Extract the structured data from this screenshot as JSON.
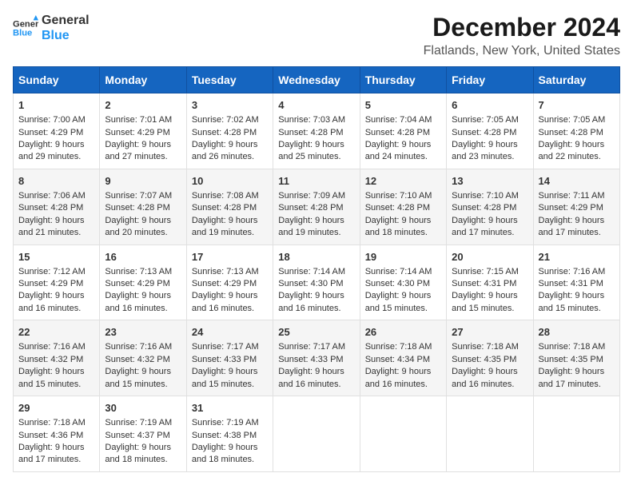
{
  "logo": {
    "line1": "General",
    "line2": "Blue"
  },
  "title": "December 2024",
  "subtitle": "Flatlands, New York, United States",
  "days_of_week": [
    "Sunday",
    "Monday",
    "Tuesday",
    "Wednesday",
    "Thursday",
    "Friday",
    "Saturday"
  ],
  "weeks": [
    [
      {
        "day": "1",
        "sunrise": "7:00 AM",
        "sunset": "4:29 PM",
        "daylight": "9 hours and 29 minutes."
      },
      {
        "day": "2",
        "sunrise": "7:01 AM",
        "sunset": "4:29 PM",
        "daylight": "9 hours and 27 minutes."
      },
      {
        "day": "3",
        "sunrise": "7:02 AM",
        "sunset": "4:28 PM",
        "daylight": "9 hours and 26 minutes."
      },
      {
        "day": "4",
        "sunrise": "7:03 AM",
        "sunset": "4:28 PM",
        "daylight": "9 hours and 25 minutes."
      },
      {
        "day": "5",
        "sunrise": "7:04 AM",
        "sunset": "4:28 PM",
        "daylight": "9 hours and 24 minutes."
      },
      {
        "day": "6",
        "sunrise": "7:05 AM",
        "sunset": "4:28 PM",
        "daylight": "9 hours and 23 minutes."
      },
      {
        "day": "7",
        "sunrise": "7:05 AM",
        "sunset": "4:28 PM",
        "daylight": "9 hours and 22 minutes."
      }
    ],
    [
      {
        "day": "8",
        "sunrise": "7:06 AM",
        "sunset": "4:28 PM",
        "daylight": "9 hours and 21 minutes."
      },
      {
        "day": "9",
        "sunrise": "7:07 AM",
        "sunset": "4:28 PM",
        "daylight": "9 hours and 20 minutes."
      },
      {
        "day": "10",
        "sunrise": "7:08 AM",
        "sunset": "4:28 PM",
        "daylight": "9 hours and 19 minutes."
      },
      {
        "day": "11",
        "sunrise": "7:09 AM",
        "sunset": "4:28 PM",
        "daylight": "9 hours and 19 minutes."
      },
      {
        "day": "12",
        "sunrise": "7:10 AM",
        "sunset": "4:28 PM",
        "daylight": "9 hours and 18 minutes."
      },
      {
        "day": "13",
        "sunrise": "7:10 AM",
        "sunset": "4:28 PM",
        "daylight": "9 hours and 17 minutes."
      },
      {
        "day": "14",
        "sunrise": "7:11 AM",
        "sunset": "4:29 PM",
        "daylight": "9 hours and 17 minutes."
      }
    ],
    [
      {
        "day": "15",
        "sunrise": "7:12 AM",
        "sunset": "4:29 PM",
        "daylight": "9 hours and 16 minutes."
      },
      {
        "day": "16",
        "sunrise": "7:13 AM",
        "sunset": "4:29 PM",
        "daylight": "9 hours and 16 minutes."
      },
      {
        "day": "17",
        "sunrise": "7:13 AM",
        "sunset": "4:29 PM",
        "daylight": "9 hours and 16 minutes."
      },
      {
        "day": "18",
        "sunrise": "7:14 AM",
        "sunset": "4:30 PM",
        "daylight": "9 hours and 16 minutes."
      },
      {
        "day": "19",
        "sunrise": "7:14 AM",
        "sunset": "4:30 PM",
        "daylight": "9 hours and 15 minutes."
      },
      {
        "day": "20",
        "sunrise": "7:15 AM",
        "sunset": "4:31 PM",
        "daylight": "9 hours and 15 minutes."
      },
      {
        "day": "21",
        "sunrise": "7:16 AM",
        "sunset": "4:31 PM",
        "daylight": "9 hours and 15 minutes."
      }
    ],
    [
      {
        "day": "22",
        "sunrise": "7:16 AM",
        "sunset": "4:32 PM",
        "daylight": "9 hours and 15 minutes."
      },
      {
        "day": "23",
        "sunrise": "7:16 AM",
        "sunset": "4:32 PM",
        "daylight": "9 hours and 15 minutes."
      },
      {
        "day": "24",
        "sunrise": "7:17 AM",
        "sunset": "4:33 PM",
        "daylight": "9 hours and 15 minutes."
      },
      {
        "day": "25",
        "sunrise": "7:17 AM",
        "sunset": "4:33 PM",
        "daylight": "9 hours and 16 minutes."
      },
      {
        "day": "26",
        "sunrise": "7:18 AM",
        "sunset": "4:34 PM",
        "daylight": "9 hours and 16 minutes."
      },
      {
        "day": "27",
        "sunrise": "7:18 AM",
        "sunset": "4:35 PM",
        "daylight": "9 hours and 16 minutes."
      },
      {
        "day": "28",
        "sunrise": "7:18 AM",
        "sunset": "4:35 PM",
        "daylight": "9 hours and 17 minutes."
      }
    ],
    [
      {
        "day": "29",
        "sunrise": "7:18 AM",
        "sunset": "4:36 PM",
        "daylight": "9 hours and 17 minutes."
      },
      {
        "day": "30",
        "sunrise": "7:19 AM",
        "sunset": "4:37 PM",
        "daylight": "9 hours and 18 minutes."
      },
      {
        "day": "31",
        "sunrise": "7:19 AM",
        "sunset": "4:38 PM",
        "daylight": "9 hours and 18 minutes."
      },
      null,
      null,
      null,
      null
    ]
  ],
  "labels": {
    "sunrise": "Sunrise:",
    "sunset": "Sunset:",
    "daylight": "Daylight:"
  }
}
